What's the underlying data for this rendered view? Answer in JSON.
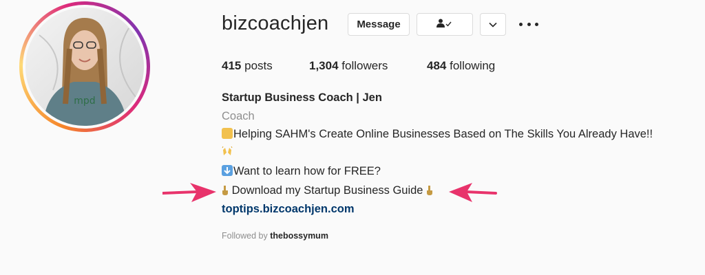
{
  "profile": {
    "username": "bizcoachjen",
    "message_label": "Message",
    "stats": {
      "posts_count": "415",
      "posts_label": "posts",
      "followers_count": "1,304",
      "followers_label": "followers",
      "following_count": "484",
      "following_label": "following"
    },
    "full_name": "Startup Business Coach | Jen",
    "category": "Coach",
    "bio": {
      "line1": "Helping SAHM's Create Online Businesses Based on The Skills You Already Have!!",
      "line2": "Want to learn how for FREE?",
      "line3": "Download my Startup Business Guide"
    },
    "link": "toptips.bizcoachjen.com",
    "followed_by_label": "Followed by",
    "followed_by_user": "thebossymum"
  },
  "colors": {
    "link": "#00376b",
    "muted": "#8e8e8e",
    "annotation_arrow": "#e8336b"
  },
  "icons": [
    "follow-check-icon",
    "chevron-down-icon",
    "more-options-icon",
    "woman-technologist-emoji",
    "raising-hands-emoji",
    "down-arrow-emoji",
    "pointing-down-emoji"
  ]
}
